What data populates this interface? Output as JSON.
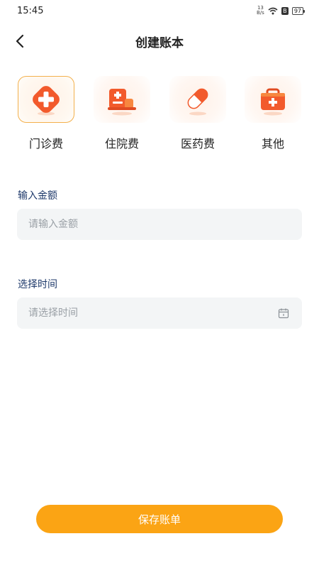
{
  "status_bar": {
    "time": "15:45",
    "net_speed_top": "13",
    "net_speed_bottom": "B/s",
    "battery": "97"
  },
  "header": {
    "title": "创建账本",
    "back_icon": "chevron-left-icon"
  },
  "categories": [
    {
      "label": "门诊费",
      "icon": "medical-cross-icon",
      "selected": true
    },
    {
      "label": "住院费",
      "icon": "hospital-bed-icon",
      "selected": false
    },
    {
      "label": "医药费",
      "icon": "pill-capsule-icon",
      "selected": false
    },
    {
      "label": "其他",
      "icon": "first-aid-kit-icon",
      "selected": false
    }
  ],
  "form": {
    "amount_label": "输入金额",
    "amount_placeholder": "请输入金额",
    "amount_value": "",
    "time_label": "选择时间",
    "time_placeholder": "请选择时间",
    "time_value": "",
    "time_icon": "calendar-icon"
  },
  "save_button": {
    "label": "保存账单"
  },
  "colors": {
    "accent": "#fba414",
    "selected_border": "#f3b04c",
    "icon_orange": "#f25a2c",
    "label_blue": "#1f3a6b",
    "field_bg": "#f3f5f6"
  }
}
